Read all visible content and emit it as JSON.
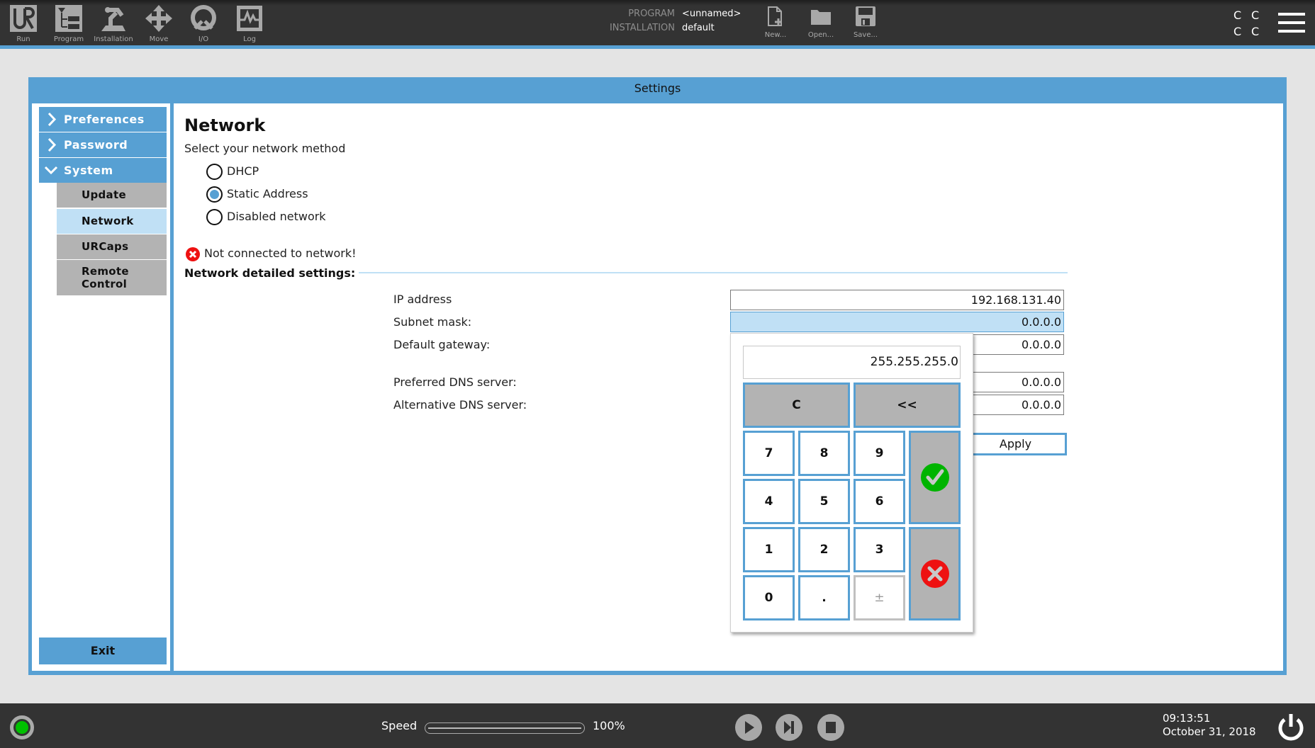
{
  "toolbar": {
    "items": [
      {
        "label": "Run",
        "icon": "ur-logo-icon"
      },
      {
        "label": "Program",
        "icon": "program-tree-icon"
      },
      {
        "label": "Installation",
        "icon": "robot-arm-icon"
      },
      {
        "label": "Move",
        "icon": "move-arrows-icon"
      },
      {
        "label": "I/O",
        "icon": "io-icon"
      },
      {
        "label": "Log",
        "icon": "log-graph-icon"
      }
    ],
    "program_label": "PROGRAM",
    "program_value": "<unnamed>",
    "installation_label": "INSTALLATION",
    "installation_value": "default",
    "file_actions": [
      {
        "label": "New...",
        "icon": "new-file-icon"
      },
      {
        "label": "Open...",
        "icon": "open-folder-icon"
      },
      {
        "label": "Save...",
        "icon": "save-disk-icon"
      }
    ],
    "status_letters": [
      "C",
      "C",
      "C",
      "C"
    ],
    "menu_icon": "hamburger-menu-icon"
  },
  "settings": {
    "title": "Settings",
    "sidebar": {
      "top_items": [
        {
          "label": "Preferences",
          "expanded": false
        },
        {
          "label": "Password",
          "expanded": false
        },
        {
          "label": "System",
          "expanded": true
        }
      ],
      "sub_items": [
        {
          "label": "Update",
          "active": false
        },
        {
          "label": "Network",
          "active": true
        },
        {
          "label": "URCaps",
          "active": false
        },
        {
          "label": "Remote\nControl",
          "active": false
        }
      ],
      "exit_label": "Exit"
    },
    "main": {
      "title": "Network",
      "method_prompt": "Select your network method",
      "methods": [
        {
          "label": "DHCP",
          "selected": false
        },
        {
          "label": "Static Address",
          "selected": true
        },
        {
          "label": "Disabled network",
          "selected": false
        }
      ],
      "status_text": "Not connected to network!",
      "status_icon": "error-x-icon",
      "detail_heading": "Network detailed settings:",
      "fields": [
        {
          "label": "IP address",
          "value": "192.168.131.40",
          "focused": false
        },
        {
          "label": "Subnet mask:",
          "value": "0.0.0.0",
          "focused": true
        },
        {
          "label": "Default gateway:",
          "value": "0.0.0.0",
          "focused": false
        },
        {
          "label": "Preferred DNS server:",
          "value": "0.0.0.0",
          "focused": false
        },
        {
          "label": "Alternative DNS server:",
          "value": "0.0.0.0",
          "focused": false
        }
      ],
      "apply_label": "Apply"
    },
    "keypad": {
      "display_value": "255.255.255.0",
      "clear_label": "C",
      "backspace_label": "<<",
      "keys": [
        "7",
        "8",
        "9",
        "4",
        "5",
        "6",
        "1",
        "2",
        "3",
        "0",
        ".",
        "±"
      ],
      "disabled_keys": [
        "±"
      ],
      "ok_icon": "green-check-icon",
      "cancel_icon": "red-x-icon"
    }
  },
  "bottombar": {
    "robot_status_color": "#00c000",
    "speed_label": "Speed",
    "speed_percent": 100,
    "speed_value": "100%",
    "controls": [
      {
        "icon": "play-icon"
      },
      {
        "icon": "step-icon"
      },
      {
        "icon": "stop-icon"
      }
    ],
    "time": "09:13:51",
    "date": "October 31, 2018",
    "power_icon": "power-icon"
  },
  "colors": {
    "accent": "#57a0d3",
    "highlight": "#c0e0f5",
    "bar": "#333333",
    "success": "#00b400",
    "error": "#ee1111"
  }
}
